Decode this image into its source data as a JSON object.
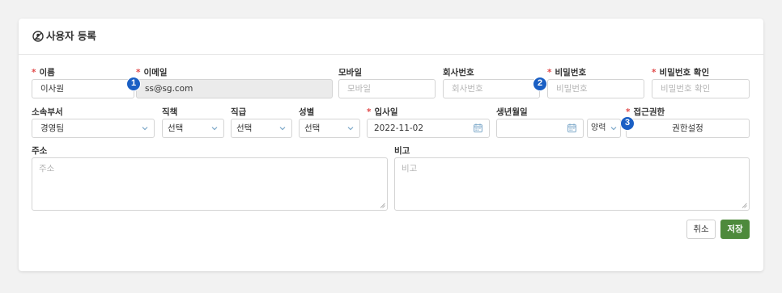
{
  "header": {
    "title": "사용자 등록",
    "icon": "user-slash-icon"
  },
  "fields": {
    "name": {
      "label": "이름",
      "required": "*",
      "value": "이사원"
    },
    "email": {
      "label": "이메일",
      "required": "*",
      "value": "ss@sg.com"
    },
    "mobile": {
      "label": "모바일",
      "placeholder": "모바일"
    },
    "company_number": {
      "label": "회사번호",
      "placeholder": "회사번호"
    },
    "password": {
      "label": "비밀번호",
      "required": "*",
      "placeholder": "비밀번호"
    },
    "password_confirm": {
      "label": "비밀번호 확인",
      "required": "*",
      "placeholder": "비밀번호 확인"
    },
    "department": {
      "label": "소속부서",
      "value": "경영팀"
    },
    "duty": {
      "label": "직책",
      "value": "선택"
    },
    "rank": {
      "label": "직급",
      "value": "선택"
    },
    "gender": {
      "label": "성별",
      "value": "선택"
    },
    "hire_date": {
      "label": "입사일",
      "required": "*",
      "value": "2022-11-02"
    },
    "birthday": {
      "label": "생년월일",
      "value": "",
      "calendar_type": "양력"
    },
    "access": {
      "label": "접근권한",
      "required": "*",
      "button_label": "권한설정"
    },
    "address": {
      "label": "주소",
      "placeholder": "주소"
    },
    "remarks": {
      "label": "비고",
      "placeholder": "비고"
    }
  },
  "badges": [
    "1",
    "2",
    "3"
  ],
  "actions": {
    "cancel": "취소",
    "save": "저장"
  },
  "colors": {
    "accent": "#4e8a3c",
    "badge": "#1a5fc4",
    "required": "#e04848"
  }
}
